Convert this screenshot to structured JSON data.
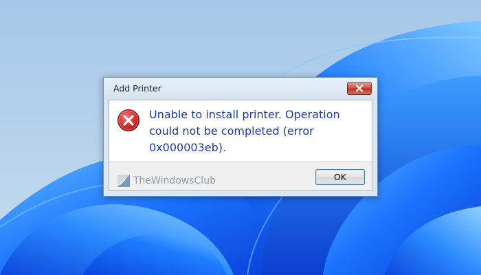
{
  "desktop": {
    "wallpaper": "windows-11-bloom",
    "colors": {
      "sky": "#a9c9e6",
      "bloom_dark": "#0a3fd0",
      "bloom_light": "#4fb0ff"
    }
  },
  "dialog": {
    "title": "Add Printer",
    "close_icon": "close-icon",
    "error_icon": "error-icon",
    "message": "Unable to install printer. Operation could not be completed (error 0x000003eb).",
    "ok_label": "OK"
  },
  "watermark": {
    "text": "TheWindowsClub"
  },
  "colors": {
    "message_text": "#1b3a99",
    "close_button": "#c7503d",
    "error_red": "#c62828",
    "dialog_frame": "#dbe7f3"
  }
}
